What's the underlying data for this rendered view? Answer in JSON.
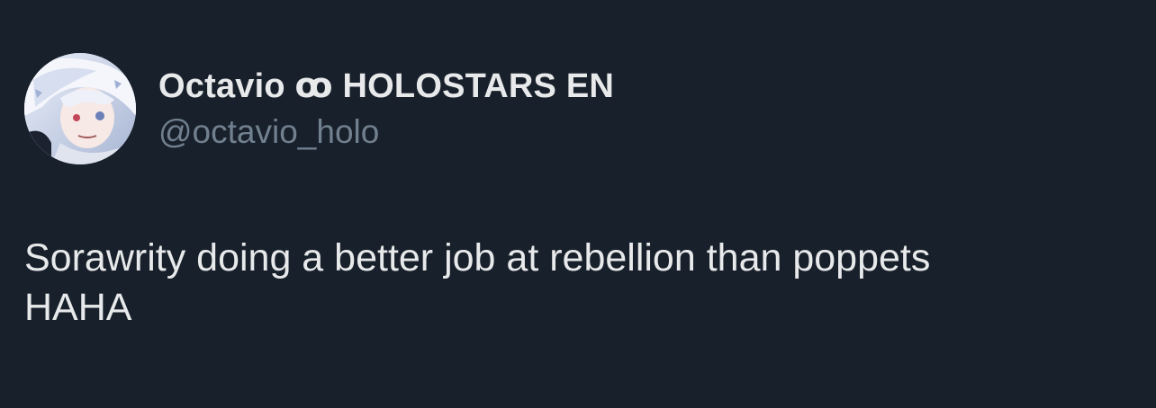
{
  "tweet": {
    "author": {
      "display_name": "Octavio ꝏ HOLOSTARS EN",
      "handle": "@octavio_holo",
      "avatar_icon": "profile-avatar-anime-character"
    },
    "text_line_1": "Sorawrity doing a better job at rebellion than poppets",
    "text_line_2": "HAHA"
  },
  "colors": {
    "background": "#18202b",
    "text_primary": "#e7e9ea",
    "text_secondary": "#71808f"
  }
}
